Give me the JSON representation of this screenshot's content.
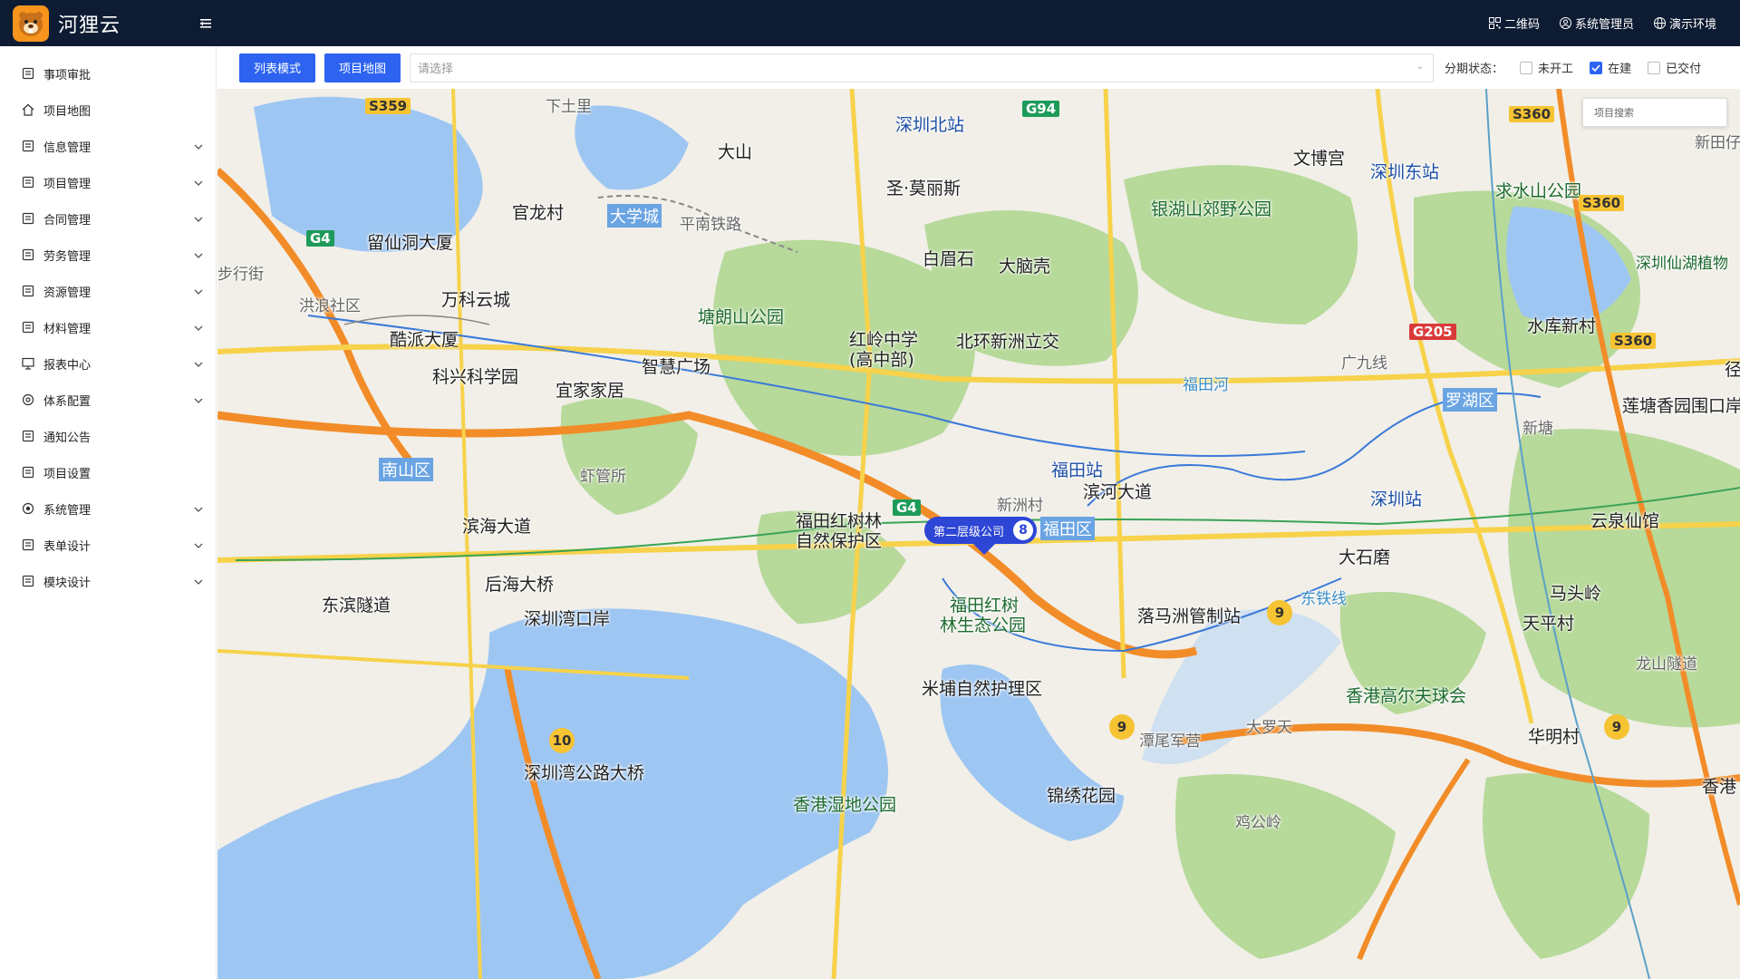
{
  "header": {
    "app_title": "河狸云",
    "qrcode_label": "二维码",
    "user_label": "系统管理员",
    "env_label": "演示环境"
  },
  "sidebar": {
    "items": [
      {
        "label": "事项审批",
        "icon": "approval-icon",
        "expandable": false
      },
      {
        "label": "项目地图",
        "icon": "home-icon",
        "expandable": false
      },
      {
        "label": "信息管理",
        "icon": "info-icon",
        "expandable": true
      },
      {
        "label": "项目管理",
        "icon": "project-icon",
        "expandable": true
      },
      {
        "label": "合同管理",
        "icon": "contract-icon",
        "expandable": true
      },
      {
        "label": "劳务管理",
        "icon": "labor-icon",
        "expandable": true
      },
      {
        "label": "资源管理",
        "icon": "resource-icon",
        "expandable": true
      },
      {
        "label": "材料管理",
        "icon": "material-icon",
        "expandable": true
      },
      {
        "label": "报表中心",
        "icon": "report-icon",
        "expandable": true
      },
      {
        "label": "体系配置",
        "icon": "config-icon",
        "expandable": true
      },
      {
        "label": "通知公告",
        "icon": "notice-icon",
        "expandable": false
      },
      {
        "label": "项目设置",
        "icon": "settings-icon",
        "expandable": false
      },
      {
        "label": "系统管理",
        "icon": "system-icon",
        "expandable": true
      },
      {
        "label": "表单设计",
        "icon": "form-icon",
        "expandable": true
      },
      {
        "label": "模块设计",
        "icon": "module-icon",
        "expandable": true
      }
    ]
  },
  "toolbar": {
    "list_mode_label": "列表模式",
    "project_map_label": "项目地图",
    "select_placeholder": "请选择",
    "status_label": "分期状态：",
    "statuses": [
      {
        "label": "未开工",
        "checked": false
      },
      {
        "label": "在建",
        "checked": true
      },
      {
        "label": "已交付",
        "checked": false
      }
    ]
  },
  "map": {
    "search_placeholder": "项目搜索",
    "cluster_label": "第二层级公司",
    "cluster_count": "8",
    "labels": {
      "l1": "大山",
      "l2": "深圳北站",
      "l3": "圣·莫丽斯",
      "l4": "文博宫",
      "l5": "深圳东站",
      "l6": "求水山公园",
      "l7": "官龙村",
      "l8": "大学城",
      "l9": "留仙洞大厦",
      "l10": "万科云城",
      "l11": "塘朗山公园",
      "l12": "白眉石",
      "l13": "大脑壳",
      "l14": "银湖山郊野公园",
      "l15": "酷派大厦",
      "l16": "红岭中学",
      "l17": "(高中部)",
      "l18": "北环新洲立交",
      "l19": "科兴科学园",
      "l20": "宜家家居",
      "l21": "智慧广场",
      "l22": "水库新村",
      "l23": "罗湖区",
      "l24": "莲塘香园围口岸",
      "l25": "南山区",
      "l26": "福田站",
      "l27": "滨河大道",
      "l28": "深圳站",
      "l29": "滨海大道",
      "l30": "福田红树林",
      "l31": "自然保护区",
      "l32": "福田区",
      "l33": "云泉仙馆",
      "l34": "后海大桥",
      "l35": "大石磨",
      "l36": "东滨隧道",
      "l37": "深圳湾口岸",
      "l38": "福田红树",
      "l39": "林生态公园",
      "l40": "落马洲管制站",
      "l41": "马头岭",
      "l42": "天平村",
      "l43": "米埔自然护理区",
      "l44": "香港高尔夫球会",
      "l45": "深圳湾公路大桥",
      "l46": "华明村",
      "l47": "香港湿地公园",
      "l48": "锦绣花园",
      "l49": "大罗天",
      "l50": "潭尾军营",
      "l51": "新洲村",
      "l52": "虾管所",
      "l53": "洪浪社区",
      "l54": "下土里",
      "l55": "东铁线",
      "l56": "深圳仙湖植物",
      "l57": "新田仔",
      "l58": "香港",
      "l59": "新塘",
      "l60": "平南铁路",
      "l61": "福田河",
      "l62": "广九线",
      "l63": "步行街",
      "l64": "鸡公岭",
      "l65": "龙山隧道",
      "l66": "径"
    },
    "badges": {
      "b1": "S359",
      "b2": "G94",
      "b3": "S360",
      "b4": "S360",
      "b5": "G4",
      "b6": "G205",
      "b7": "S360",
      "b8": "G4",
      "b9": "9",
      "b10": "9",
      "b11": "9",
      "b12": "10"
    }
  },
  "colors": {
    "header_bg": "#0e1c33",
    "primary": "#2d63f0",
    "cluster": "#2d46d6"
  }
}
